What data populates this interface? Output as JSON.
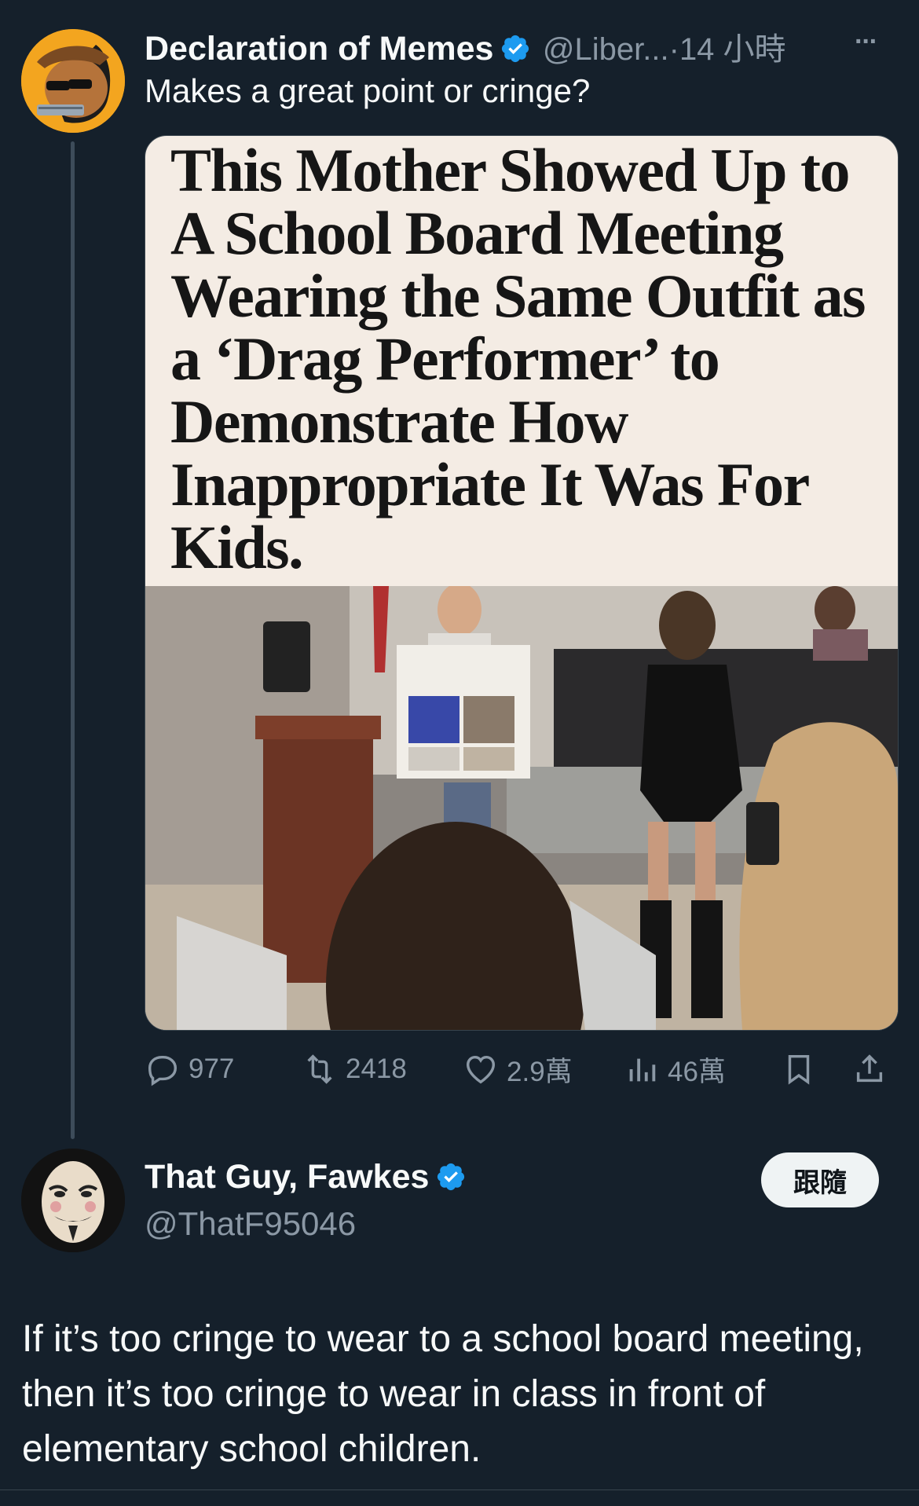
{
  "post": {
    "author_name": "Declaration of Memes",
    "author_handle": "@Liber...",
    "separator": "·",
    "time": "14 小時",
    "more_label": "···",
    "text": "Makes a great point or cringe?",
    "image_headline": "This Mother Showed Up to A School Board Meeting Wearing the Same Outfit as a ‘Drag Performer’ to Demonstrate How Inappropriate It Was For Kids.",
    "stats": {
      "replies": "977",
      "reposts": "2418",
      "likes": "2.9萬",
      "views": "46萬"
    }
  },
  "reply": {
    "author_name": "That Guy, Fawkes",
    "author_handle": "@ThatF95046",
    "follow_label": "跟隨",
    "text": "If it’s too cringe to wear to a school board meeting, then it’s too cringe to wear in class in front of elementary school children."
  },
  "colors": {
    "background": "#15202b",
    "verified": "#1d9bf0",
    "muted": "#8b98a5"
  }
}
